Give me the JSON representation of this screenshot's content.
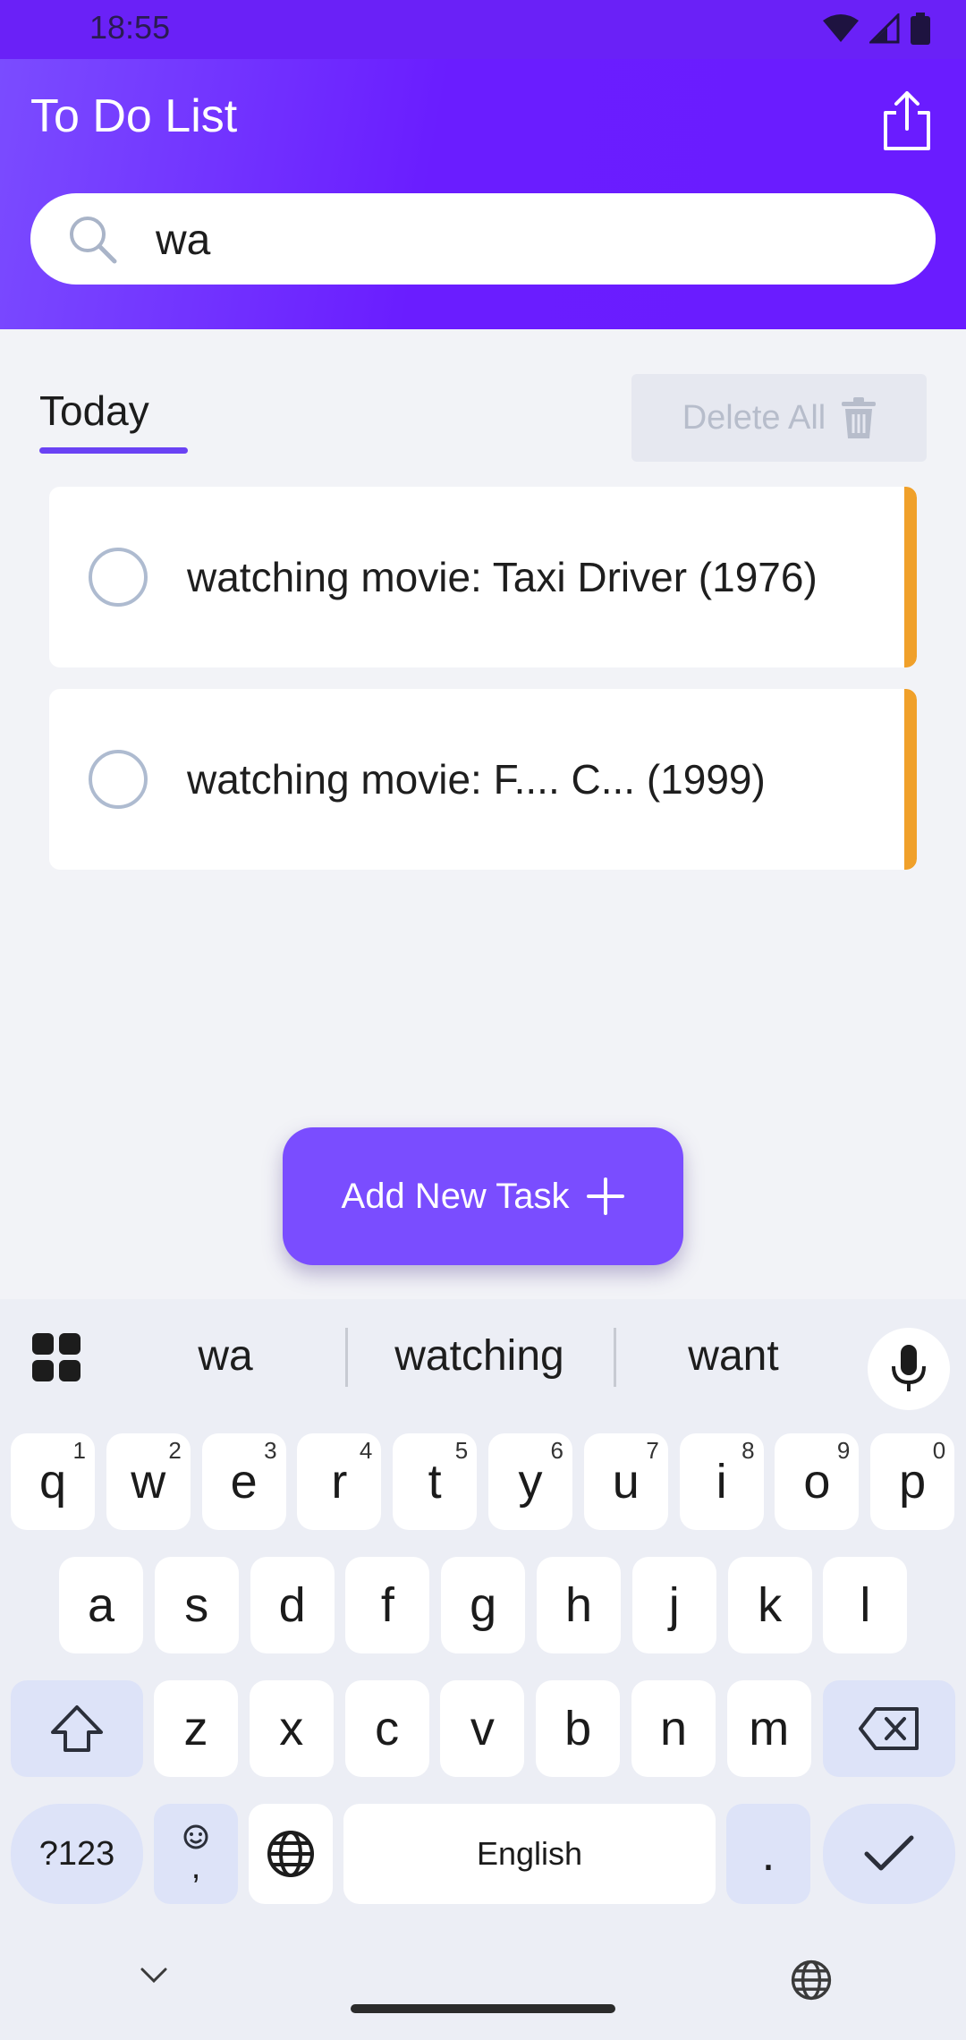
{
  "status_bar": {
    "time": "18:55"
  },
  "header": {
    "title": "To Do List"
  },
  "search": {
    "value": "wa"
  },
  "tabs": {
    "active": "Today"
  },
  "actions": {
    "delete_all": "Delete All",
    "add_task": "Add New Task"
  },
  "tasks": [
    {
      "title": "watching movie: Taxi Driver (1976)"
    },
    {
      "title": "watching movie: F.... C... (1999)"
    }
  ],
  "keyboard": {
    "suggestions": [
      "wa",
      "watching",
      "want"
    ],
    "row1": [
      {
        "k": "q",
        "h": "1"
      },
      {
        "k": "w",
        "h": "2"
      },
      {
        "k": "e",
        "h": "3"
      },
      {
        "k": "r",
        "h": "4"
      },
      {
        "k": "t",
        "h": "5"
      },
      {
        "k": "y",
        "h": "6"
      },
      {
        "k": "u",
        "h": "7"
      },
      {
        "k": "i",
        "h": "8"
      },
      {
        "k": "o",
        "h": "9"
      },
      {
        "k": "p",
        "h": "0"
      }
    ],
    "row2": [
      "a",
      "s",
      "d",
      "f",
      "g",
      "h",
      "j",
      "k",
      "l"
    ],
    "row3": [
      "z",
      "x",
      "c",
      "v",
      "b",
      "n",
      "m"
    ],
    "symbols_key": "?123",
    "comma_key": ",",
    "space_label": "English",
    "period_key": "."
  },
  "colors": {
    "header_start": "#7b4dff",
    "header_end": "#6a1cff",
    "accent": "#6a42f4",
    "priority_bar": "#f0a02a",
    "fab": "#7a4dff"
  }
}
